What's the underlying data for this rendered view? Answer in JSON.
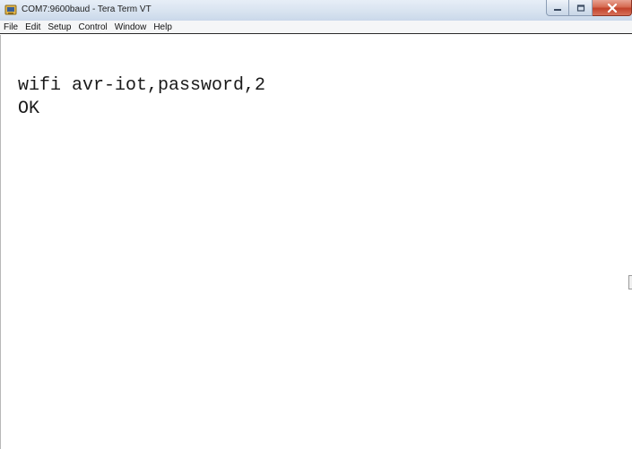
{
  "window": {
    "title": "COM7:9600baud - Tera Term VT",
    "icon": "teraterm-app-icon",
    "caption_buttons": [
      "minimize-icon",
      "maximize-icon",
      "close-icon"
    ]
  },
  "menu": {
    "items": [
      {
        "label": "File"
      },
      {
        "label": "Edit"
      },
      {
        "label": "Setup"
      },
      {
        "label": "Control"
      },
      {
        "label": "Window"
      },
      {
        "label": "Help"
      }
    ]
  },
  "terminal": {
    "lines": [
      "wifi avr-iot,password,2",
      "OK"
    ],
    "text_color": "#1a1a1a",
    "background": "#ffffff"
  },
  "colors": {
    "titlebar": "#d8e3f0",
    "close_button": "#c2422a",
    "menubar": "#f5f6f7"
  }
}
